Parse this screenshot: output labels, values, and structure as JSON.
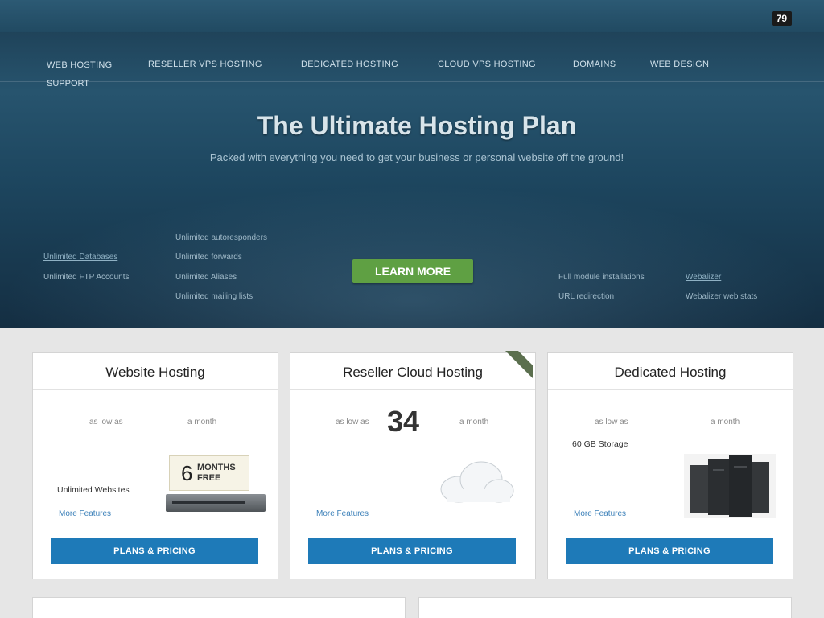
{
  "header": {
    "phone": "79"
  },
  "nav": {
    "web_hosting": "WEB HOSTING",
    "support": "SUPPORT",
    "items": [
      {
        "label": "RESELLER VPS HOSTING"
      },
      {
        "label": "DEDICATED HOSTING"
      },
      {
        "label": "CLOUD VPS HOSTING"
      },
      {
        "label": "DOMAINS"
      },
      {
        "label": "WEB DESIGN"
      }
    ]
  },
  "hero": {
    "title": "The Ultimate Hosting Plan",
    "subtitle": "Packed with everything you need to get your business or personal website off the ground!",
    "left_links": [
      "",
      "",
      "",
      "",
      "Unlimited Databases",
      "Unlimited FTP Accounts"
    ],
    "center_left_items": [
      "",
      "",
      "",
      "Unlimited autoresponders",
      "Unlimited forwards",
      "Unlimited Aliases",
      "Unlimited mailing lists"
    ],
    "center_right_items": [
      "",
      "",
      "",
      "",
      "",
      "Full module installations",
      "URL redirection"
    ],
    "right_links": [
      "",
      "",
      "",
      "",
      "",
      "Webalizer",
      "Webalizer web stats"
    ],
    "learn_more": "LEARN MORE"
  },
  "cards": [
    {
      "heading": "Website Hosting",
      "as_low": "as low as",
      "per": "a month",
      "features": [
        "",
        "",
        "",
        "Unlimited Websites"
      ],
      "more": "More Features",
      "button": "PLANS & PRICING",
      "promo_number": "6",
      "promo_text": "MONTHS FREE"
    },
    {
      "heading": "Reseller Cloud Hosting",
      "as_low": "as low as",
      "price": "34",
      "per": "a month",
      "features": [
        "",
        "",
        "",
        "",
        ""
      ],
      "more": "More Features",
      "button": "PLANS & PRICING"
    },
    {
      "heading": "Dedicated Hosting",
      "as_low": "as low as",
      "per": "a month",
      "features": [
        "60 GB Storage",
        "",
        ""
      ],
      "more": "More Features",
      "button": "PLANS & PRICING"
    }
  ]
}
